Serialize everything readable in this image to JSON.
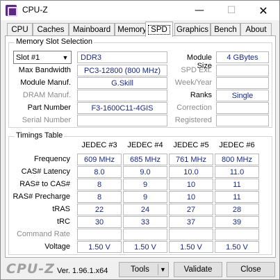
{
  "window": {
    "title": "CPU-Z",
    "minimize": "—",
    "maximize": "☐",
    "close": "✕"
  },
  "tabs": [
    "CPU",
    "Caches",
    "Mainboard",
    "Memory",
    "SPD",
    "Graphics",
    "Bench",
    "About"
  ],
  "active_tab": "SPD",
  "slot": {
    "group_title": "Memory Slot Selection",
    "selected": "Slot #1",
    "type": "DDR3",
    "module_size_label": "Module Size",
    "module_size": "4 GBytes",
    "max_bandwidth_label": "Max Bandwidth",
    "max_bandwidth": "PC3-12800 (800 MHz)",
    "spd_ext_label": "SPD Ext.",
    "spd_ext": "",
    "module_manuf_label": "Module Manuf.",
    "module_manuf": "G.Skill",
    "week_year_label": "Week/Year",
    "week_year": "",
    "dram_manuf_label": "DRAM Manuf.",
    "dram_manuf": "",
    "ranks_label": "Ranks",
    "ranks": "Single",
    "part_number_label": "Part Number",
    "part_number": "F3-1600C11-4GIS",
    "correction_label": "Correction",
    "correction": "",
    "serial_number_label": "Serial Number",
    "serial_number": "",
    "registered_label": "Registered",
    "registered": ""
  },
  "timings": {
    "group_title": "Timings Table",
    "columns": [
      "JEDEC #3",
      "JEDEC #4",
      "JEDEC #5",
      "JEDEC #6"
    ],
    "rows": [
      {
        "label": "Frequency",
        "dim": false,
        "values": [
          "609 MHz",
          "685 MHz",
          "761 MHz",
          "800 MHz"
        ]
      },
      {
        "label": "CAS# Latency",
        "dim": false,
        "values": [
          "8.0",
          "9.0",
          "10.0",
          "11.0"
        ]
      },
      {
        "label": "RAS# to CAS#",
        "dim": false,
        "values": [
          "8",
          "9",
          "10",
          "11"
        ]
      },
      {
        "label": "RAS# Precharge",
        "dim": false,
        "values": [
          "8",
          "9",
          "10",
          "11"
        ]
      },
      {
        "label": "tRAS",
        "dim": false,
        "values": [
          "22",
          "24",
          "27",
          "28"
        ]
      },
      {
        "label": "tRC",
        "dim": false,
        "values": [
          "30",
          "33",
          "37",
          "39"
        ]
      },
      {
        "label": "Command Rate",
        "dim": true,
        "values": [
          "",
          "",
          "",
          ""
        ]
      },
      {
        "label": "Voltage",
        "dim": false,
        "values": [
          "1.50 V",
          "1.50 V",
          "1.50 V",
          "1.50 V"
        ]
      }
    ]
  },
  "footer": {
    "logo": "CPU-Z",
    "version": "Ver. 1.96.1.x64",
    "tools_label": "Tools",
    "validate_label": "Validate",
    "close_label": "Close"
  }
}
